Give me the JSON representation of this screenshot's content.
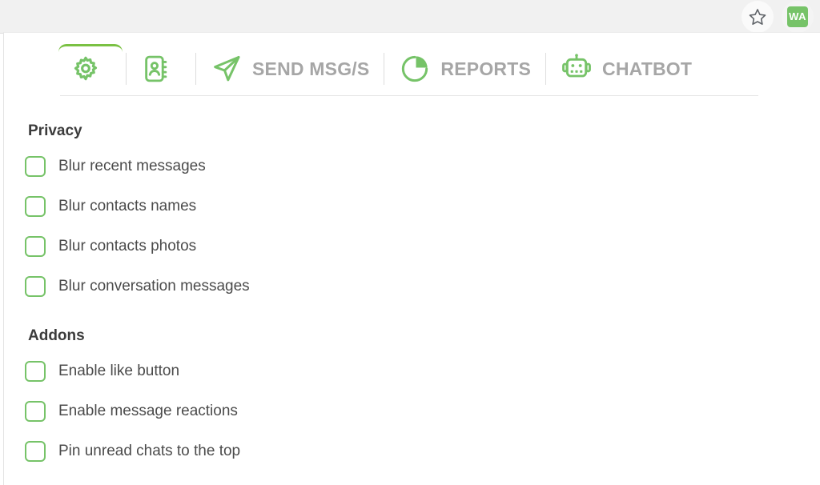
{
  "browser": {
    "bookmark_icon": "star-icon",
    "extension_badge_label": "WA"
  },
  "toolbar": {
    "tabs": [
      {
        "id": "settings",
        "label": "",
        "icon": "gear-icon",
        "active": true
      },
      {
        "id": "contacts",
        "label": "",
        "icon": "address-book-icon",
        "active": false
      },
      {
        "id": "send-msgs",
        "label": "SEND MSG/S",
        "icon": "paper-plane-icon",
        "active": false
      },
      {
        "id": "reports",
        "label": "REPORTS",
        "icon": "pie-chart-icon",
        "active": false
      },
      {
        "id": "chatbot",
        "label": "CHATBOT",
        "icon": "robot-icon",
        "active": false
      }
    ]
  },
  "colors": {
    "accent_green": "#76c368",
    "active_tab_green": "#7ac143",
    "label_gray": "#a6a6a6",
    "text_gray": "#4b4b4b",
    "heading_gray": "#3c3c3c"
  },
  "sections": [
    {
      "title": "Privacy",
      "options": [
        {
          "label": "Blur recent messages",
          "checked": false
        },
        {
          "label": "Blur contacts names",
          "checked": false
        },
        {
          "label": "Blur contacts photos",
          "checked": false
        },
        {
          "label": "Blur conversation messages",
          "checked": false
        }
      ]
    },
    {
      "title": "Addons",
      "options": [
        {
          "label": "Enable like button",
          "checked": false
        },
        {
          "label": "Enable message reactions",
          "checked": false
        },
        {
          "label": "Pin unread chats to the top",
          "checked": false
        }
      ]
    }
  ]
}
